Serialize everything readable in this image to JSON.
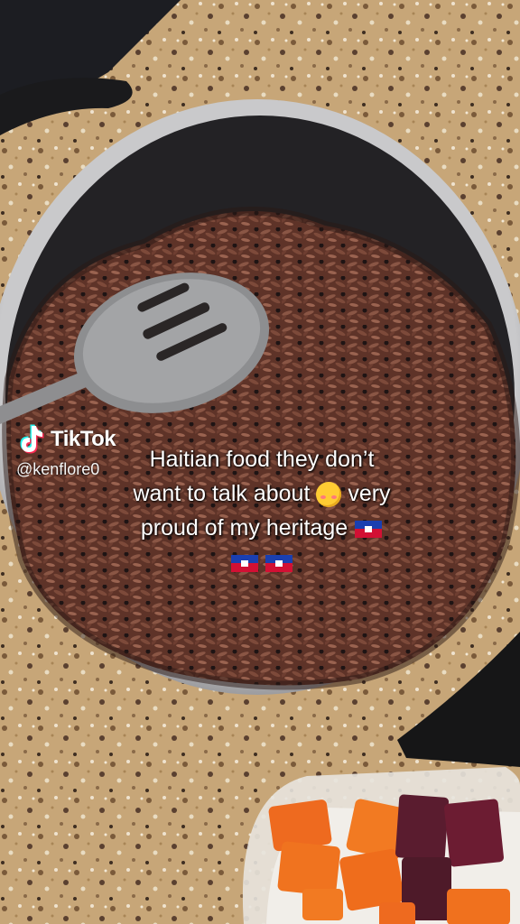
{
  "watermark": {
    "brand": "TikTok",
    "username": "@kenflore0"
  },
  "caption": {
    "line1": "Haitian food they don’t",
    "line2_a": "want to talk about",
    "line2_b": "very",
    "line3": "proud of my heritage",
    "emoji_name": "smiling-face-with-hearts-icon",
    "flag_name": "haiti-flag-icon"
  },
  "scene": {
    "subject": "pot of diri kole (rice and black beans) with slotted spoon, bowl of carrots and beets on granite counter"
  }
}
